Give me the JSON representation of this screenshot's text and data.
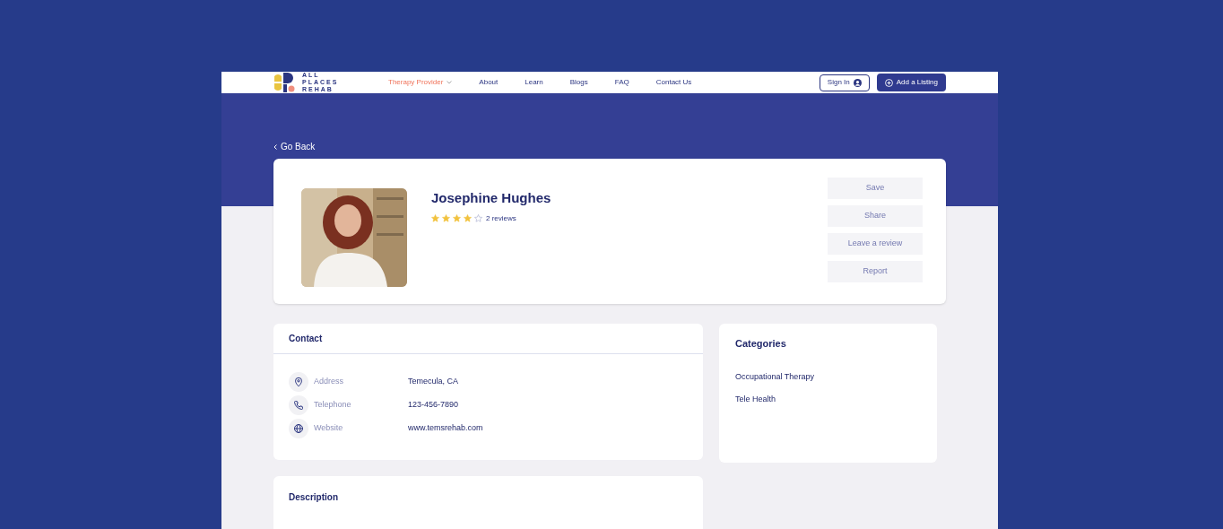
{
  "logo": {
    "lines": [
      "ALL",
      "PLACES",
      "REHAB"
    ]
  },
  "nav": [
    {
      "label": "Therapy Provider",
      "selected": true,
      "dropdown": true
    },
    {
      "label": "About",
      "selected": false,
      "dropdown": false
    },
    {
      "label": "Learn",
      "selected": false,
      "dropdown": false
    },
    {
      "label": "Blogs",
      "selected": false,
      "dropdown": false
    },
    {
      "label": "FAQ",
      "selected": false,
      "dropdown": false
    },
    {
      "label": "Contact Us",
      "selected": false,
      "dropdown": false
    }
  ],
  "sign_in": "Sign In",
  "add_listing": "Add a Listing",
  "go_back": "Go Back",
  "profile": {
    "name": "Josephine Hughes",
    "stars": 4,
    "reviews": "2 reviews",
    "actions": [
      "Save",
      "Share",
      "Leave a review",
      "Report"
    ]
  },
  "contact": {
    "title": "Contact",
    "rows": [
      {
        "kind": "address",
        "label": "Address",
        "value": "Temecula, CA"
      },
      {
        "kind": "telephone",
        "label": "Telephone",
        "value": "123-456-7890"
      },
      {
        "kind": "website",
        "label": "Website",
        "value": "www.temsrehab.com"
      }
    ]
  },
  "categories": {
    "title": "Categories",
    "items": [
      "Occupational Therapy",
      "Tele Health"
    ]
  },
  "description": {
    "title": "Description"
  }
}
